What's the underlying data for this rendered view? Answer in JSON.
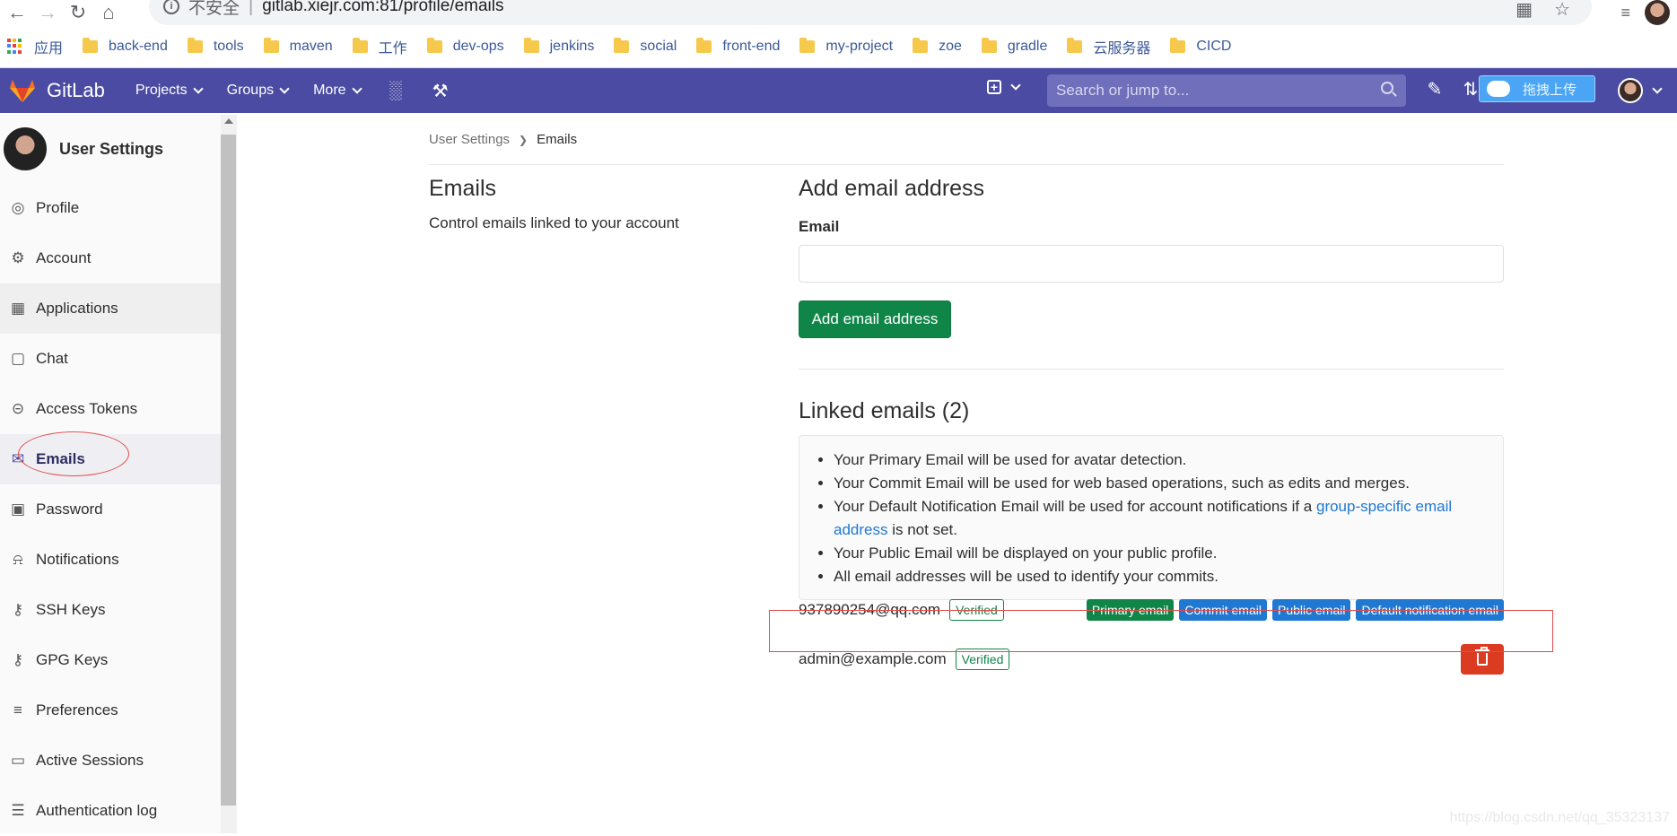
{
  "browser": {
    "insecure_label": "不安全",
    "url": "gitlab.xiejr.com:81/profile/emails",
    "bookmarks": [
      {
        "label": "应用",
        "type": "apps"
      },
      {
        "label": "back-end"
      },
      {
        "label": "tools"
      },
      {
        "label": "maven"
      },
      {
        "label": "工作"
      },
      {
        "label": "dev-ops"
      },
      {
        "label": "jenkins"
      },
      {
        "label": "social"
      },
      {
        "label": "front-end"
      },
      {
        "label": "my-project"
      },
      {
        "label": "zoe"
      },
      {
        "label": "gradle"
      },
      {
        "label": "云服务器"
      },
      {
        "label": "CICD"
      }
    ]
  },
  "header": {
    "brand": "GitLab",
    "nav": [
      "Projects",
      "Groups",
      "More"
    ],
    "search_placeholder": "Search or jump to...",
    "upload_label": "拖拽上传",
    "color": "#4b4ba3"
  },
  "sidebar": {
    "title": "User Settings",
    "items": [
      {
        "label": "Profile",
        "icon": "profile-icon"
      },
      {
        "label": "Account",
        "icon": "account-icon"
      },
      {
        "label": "Applications",
        "icon": "applications-icon"
      },
      {
        "label": "Chat",
        "icon": "chat-icon"
      },
      {
        "label": "Access Tokens",
        "icon": "token-icon"
      },
      {
        "label": "Emails",
        "icon": "mail-icon",
        "active": true
      },
      {
        "label": "Password",
        "icon": "lock-icon"
      },
      {
        "label": "Notifications",
        "icon": "bell-icon"
      },
      {
        "label": "SSH Keys",
        "icon": "key-icon"
      },
      {
        "label": "GPG Keys",
        "icon": "key-icon"
      },
      {
        "label": "Preferences",
        "icon": "preferences-icon"
      },
      {
        "label": "Active Sessions",
        "icon": "monitor-icon"
      },
      {
        "label": "Authentication log",
        "icon": "list-icon"
      }
    ]
  },
  "main": {
    "breadcrumb": {
      "parent": "User Settings",
      "current": "Emails"
    },
    "left": {
      "title": "Emails",
      "description": "Control emails linked to your account"
    },
    "add": {
      "title": "Add email address",
      "email_label": "Email",
      "input_value": "",
      "button": "Add email address"
    },
    "linked": {
      "title": "Linked emails (2)",
      "info": [
        {
          "text": "Your Primary Email will be used for avatar detection."
        },
        {
          "text": "Your Commit Email will be used for web based operations, such as edits and merges."
        },
        {
          "text_before": "Your Default Notification Email will be used for account notifications if a ",
          "link": "group-specific email address",
          "text_after": " is not set."
        },
        {
          "text": "Your Public Email will be displayed on your public profile."
        },
        {
          "text": "All email addresses will be used to identify your commits."
        }
      ],
      "emails": [
        {
          "address": "937890254@qq.com",
          "status": "Verified",
          "badges": [
            "Primary email",
            "Commit email",
            "Public email",
            "Default notification email"
          ]
        },
        {
          "address": "admin@example.com",
          "status": "Verified",
          "badges": []
        }
      ]
    }
  },
  "watermark": "https://blog.csdn.net/qq_35323137"
}
